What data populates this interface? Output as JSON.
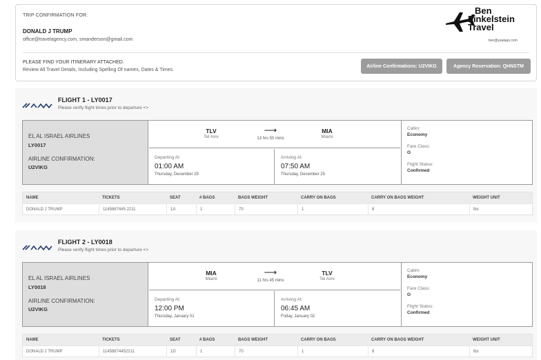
{
  "header": {
    "label": "TRIP CONFIRMATION FOR:",
    "name": "DONALD J TRUMP",
    "emails": "office@travelagency.com, smanderson@gmail.com",
    "itinerary_note": "PLEASE FIND YOUR ITINERARY ATTACHED.",
    "review_note": "Review All Travel Details, Including Spelling Of names, Dates & Times.",
    "airline_conf_button": "Airline Confirmations: U2VIKG",
    "agency_res_button": "Agency Reservation: QHNSTM"
  },
  "logo": {
    "line1": "Ben",
    "line2": "Finkelstein",
    "line3": "Travel",
    "email": "ben@yaalago.com"
  },
  "table_headers": [
    "NAME",
    "TICKETS",
    "SEAT",
    "# BAGS",
    "BAGS WEIGHT",
    "CARRY ON BAGS",
    "CARRY ON BAGS WEIGHT",
    "WEIGHT UNIT"
  ],
  "flights": [
    {
      "title": "FLIGHT 1 - LY0017",
      "subtitle": "Please verify flight times prior to departure <>",
      "airline": "EL AL ISRAEL AIRLINES",
      "flight_no": "LY0017",
      "airline_conf_label": "AIRLINE CONFIRMATION:",
      "airline_conf": "U2VIKG",
      "from_code": "TLV",
      "from_city": "Tel Aviv",
      "to_code": "MIA",
      "to_city": "Miami",
      "duration": "13 hrs 50 mins",
      "arrow": "⟶",
      "depart_label": "Departing At:",
      "depart_time": "01:00 AM",
      "depart_date": "Thursday, December 25",
      "arrive_label": "Arriving At:",
      "arrive_time": "07:50 AM",
      "arrive_date": "Thursday, December 25",
      "cabin_label": "Cabin:",
      "cabin": "Economy",
      "fare_label": "Fare Class:",
      "fare": "O",
      "status_label": "Flight Status:",
      "status": "Confirmed",
      "passengers": [
        [
          "DONALD J TRUMP",
          "1145887445 2211",
          "1A",
          "1",
          "70",
          "1",
          "8",
          "lbs"
        ]
      ]
    },
    {
      "title": "FLIGHT 2 - LY0018",
      "subtitle": "Please verify flight times prior to departure <>",
      "airline": "EL AL ISRAEL AIRLINES",
      "flight_no": "LY0018",
      "airline_conf_label": "AIRLINE CONFIRMATION:",
      "airline_conf": "U2VIKG",
      "from_code": "MIA",
      "from_city": "Miami",
      "to_code": "TLV",
      "to_city": "Tel Aviv",
      "duration": "11 hrs 45 mins",
      "arrow": "⟶",
      "depart_label": "Departing At:",
      "depart_time": "12:00 PM",
      "depart_date": "Thursday, January 01",
      "arrive_label": "Arriving At:",
      "arrive_time": "06:45 AM",
      "arrive_date": "Friday, January 02",
      "cabin_label": "Cabin:",
      "cabin": "Economy",
      "fare_label": "Fare Class:",
      "fare": "O",
      "status_label": "Flight Status:",
      "status": "Confirmed",
      "passengers": [
        [
          "DONALD J TRUMP",
          "11458874452211",
          "1D",
          "1",
          "70",
          "1",
          "8",
          "lbs"
        ]
      ]
    }
  ]
}
